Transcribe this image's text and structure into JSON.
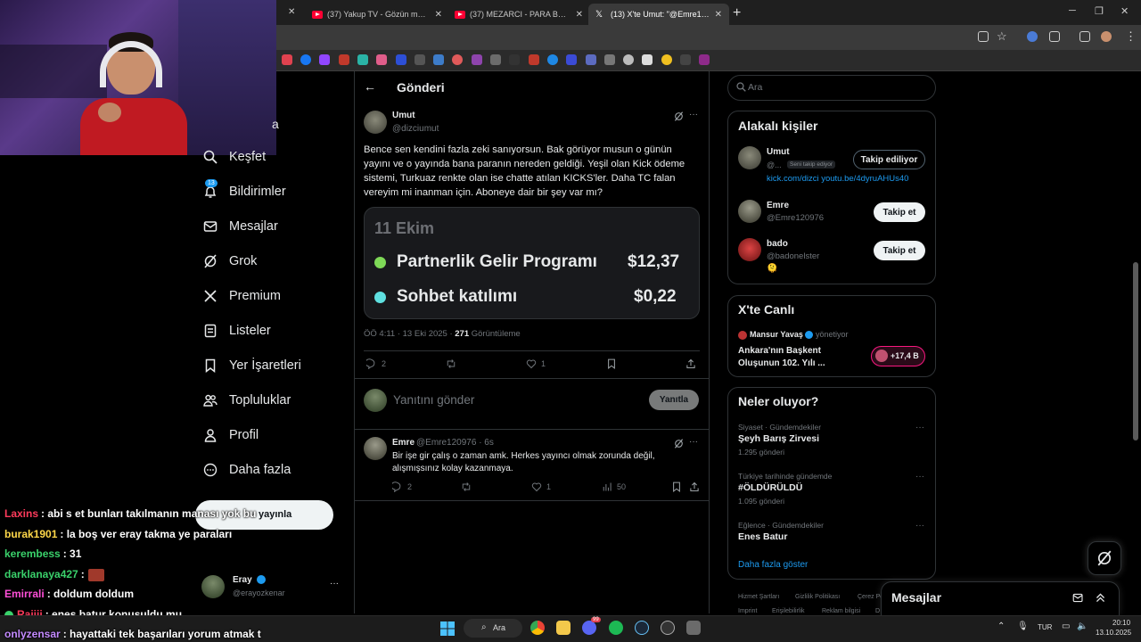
{
  "browser": {
    "tabs": [
      {
        "title": "(37) Yakup TV - Gözün mü açıld",
        "icon": "youtube-icon"
      },
      {
        "title": "(37) MEZARCI - PARA BENİ BOZ",
        "icon": "youtube-icon"
      },
      {
        "title": "(13) X'te Umut: \"@Emre120976",
        "icon": "x-icon"
      }
    ],
    "new_tab": "+",
    "close": "✕",
    "window_controls": [
      "─",
      "❐",
      "✕"
    ]
  },
  "nav": {
    "partial_label": "a",
    "items": [
      {
        "label": "Keşfet",
        "icon": "search-icon"
      },
      {
        "label": "Bildirimler",
        "icon": "bell-icon",
        "badge": "13"
      },
      {
        "label": "Mesajlar",
        "icon": "mail-icon"
      },
      {
        "label": "Grok",
        "icon": "grok-icon"
      },
      {
        "label": "Premium",
        "icon": "x-icon"
      },
      {
        "label": "Listeler",
        "icon": "list-icon"
      },
      {
        "label": "Yer İşaretleri",
        "icon": "bookmark-icon"
      },
      {
        "label": "Topluluklar",
        "icon": "people-icon"
      },
      {
        "label": "Profil",
        "icon": "person-icon"
      },
      {
        "label": "Daha fazla",
        "icon": "more-circle-icon"
      }
    ],
    "post_button": "yayınla",
    "account": {
      "name": "Eray",
      "handle": "@erayozkenar",
      "more": "···"
    }
  },
  "header": {
    "back": "←",
    "title": "Gönderi"
  },
  "post": {
    "author": "Umut",
    "handle": "@dizciumut",
    "more": "···",
    "text": "Bence sen kendini fazla zeki sanıyorsun. Bak görüyor musun o günün yayını ve o yayında bana paranın nereden geldiği. Yeşil olan Kick ödeme sistemi, Turkuaz renkte olan ise chatte atılan KICKS'ler. Daha TC falan vereyim mi inanman için. Aboneye dair bir şey var mı?",
    "media": {
      "date": "11 Ekim",
      "rows": [
        {
          "label": "Partnerlik Gelir Programı",
          "value": "$12,37",
          "color": "#7ed957"
        },
        {
          "label": "Sohbet katılımı",
          "value": "$0,22",
          "color": "#5fe0e0"
        }
      ]
    },
    "meta_time": "ÖÖ 4:11 · 13 Eki 2025 · ",
    "meta_views": "271",
    "meta_views_label": " Görüntüleme",
    "replies": "2",
    "likes": "1"
  },
  "reply_box": {
    "placeholder": "Yanıtını gönder",
    "button": "Yanıtla"
  },
  "reply": {
    "author": "Emre",
    "handle_time": "@Emre120976 · 6s",
    "text": "Bir işe gir çalış o zaman amk. Herkes yayıncı olmak zorunda değil, alışmışsınız kolay kazanmaya.",
    "replies": "2",
    "likes": "1",
    "views": "50",
    "more": "···"
  },
  "search": {
    "placeholder": "Ara"
  },
  "related": {
    "title": "Alakalı kişiler",
    "people": [
      {
        "name": "Umut",
        "handle": "@...",
        "badge": "Seni takip ediyor",
        "button": "Takip ediliyor",
        "bio": "kick.com/dizci youtu.be/4dyruAHUs40"
      },
      {
        "name": "Emre",
        "handle": "@Emre120976",
        "button": "Takip et"
      },
      {
        "name": "bado",
        "handle": "@badonelster",
        "button": "Takip et",
        "bio": "🫠"
      }
    ]
  },
  "live": {
    "title": "X'te Canlı",
    "host": "Mansur Yavaş",
    "role": "yönetiyor",
    "space_title": "Ankara'nın Başkent Oluşunun 102. Yılı ...",
    "listeners": "+17,4 B"
  },
  "trends": {
    "title": "Neler oluyor?",
    "items": [
      {
        "context": "Siyaset · Gündemdekiler",
        "name": "Şeyh Barış Zirvesi",
        "count": "1.295 gönderi"
      },
      {
        "context": "Türkiye tarihinde gündemde",
        "name": "#ÖLDÜRÜLDÜ",
        "count": "1.095 gönderi"
      },
      {
        "context": "Eğlence · Gündemdekiler",
        "name": "Enes Batur",
        "count": ""
      }
    ],
    "more": "···",
    "show_more": "Daha fazla göster"
  },
  "footer": {
    "links": [
      "Hizmet Şartları",
      "Gizlilik Politikası",
      "Çerez Po",
      "Imprint",
      "Erişilebilirlik",
      "Reklam bilgisi",
      "D"
    ]
  },
  "messages_drawer": {
    "title": "Mesajlar"
  },
  "chat": [
    {
      "user": "Laxins",
      "color": "#ff3b5c",
      "text": ": abi s et bunları takılmanın manası yok bu"
    },
    {
      "user": "burak1901",
      "color": "#ffd84a",
      "text": ": la boş ver eray takma ye paraları"
    },
    {
      "user": "kerembess",
      "color": "#3ad16b",
      "text": ": 31"
    },
    {
      "user": "darklanaya427",
      "color": "#3ad16b",
      "text": ":"
    },
    {
      "user": "Emirrali",
      "color": "#ff4fd8",
      "text": ": doldum doldum"
    },
    {
      "user": "Raiiii",
      "color": "#ff3b5c",
      "text": ": enes batur konuşuldu mu"
    },
    {
      "user": "onlyzensar",
      "color": "#c48bff",
      "text": ": hayattaki tek başarıları yorum atmak t"
    }
  ],
  "taskbar": {
    "search": "Ara",
    "lang": "TUR",
    "time": "20:10",
    "date": "13.10.2025",
    "badge": "99"
  },
  "colors": {
    "accent": "#1d9bf0",
    "bg": "#000000",
    "border": "#2f3336",
    "muted": "#71767b"
  }
}
